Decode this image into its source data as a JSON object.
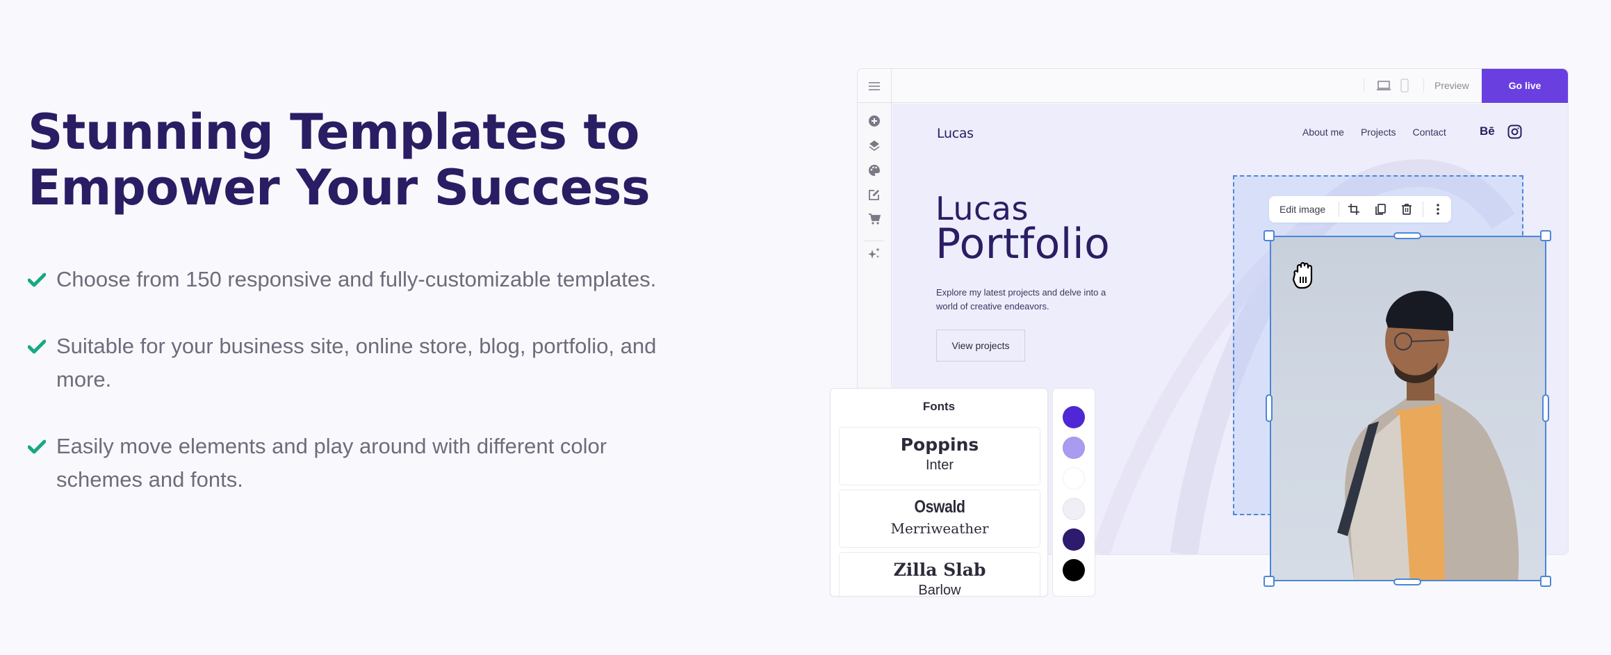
{
  "hero": {
    "title": "Stunning Templates to Empower Your Success",
    "features": [
      "Choose from 150 responsive and fully-customizable templates.",
      "Suitable for your business site, online store, blog, portfolio, and more.",
      "Easily move elements and play around with different color schemes and fonts."
    ],
    "check_color": "#17a884"
  },
  "editor": {
    "topbar": {
      "menu_icon": "hamburger-icon",
      "device_icons": [
        "laptop-icon",
        "mobile-icon"
      ],
      "preview_label": "Preview",
      "golive_label": "Go live",
      "accent_color": "#6a3fe0"
    },
    "sidebar_icons": [
      "add-circle-icon",
      "layers-icon",
      "palette-icon",
      "edit-icon",
      "cart-icon",
      "sparkles-icon"
    ],
    "site": {
      "logo": "Lucas",
      "nav": [
        "About me",
        "Projects",
        "Contact"
      ],
      "social_icons": [
        "behance-icon",
        "instagram-icon"
      ],
      "behance_label": "Bē",
      "headline_line1": "Lucas",
      "headline_line2": "Portfolio",
      "subtitle": "Explore my latest projects and delve into a world of creative endeavors.",
      "cta_label": "View projects",
      "text_color": "#2a1d63"
    },
    "image_toolbar": {
      "label": "Edit image",
      "actions": [
        "crop-icon",
        "duplicate-icon",
        "delete-icon",
        "more-vertical-icon"
      ]
    },
    "selection_color": "#4a86d8"
  },
  "fonts_panel": {
    "title": "Fonts",
    "pairs": [
      {
        "primary": "Poppins",
        "secondary": "Inter"
      },
      {
        "primary": "Oswald",
        "secondary": "Merriweather"
      },
      {
        "primary": "Zilla Slab",
        "secondary": "Barlow"
      }
    ]
  },
  "color_palette": [
    "#5027d6",
    "#a99cf0",
    "#ffffff",
    "#efeff5",
    "#2e1a6e",
    "#000000"
  ]
}
